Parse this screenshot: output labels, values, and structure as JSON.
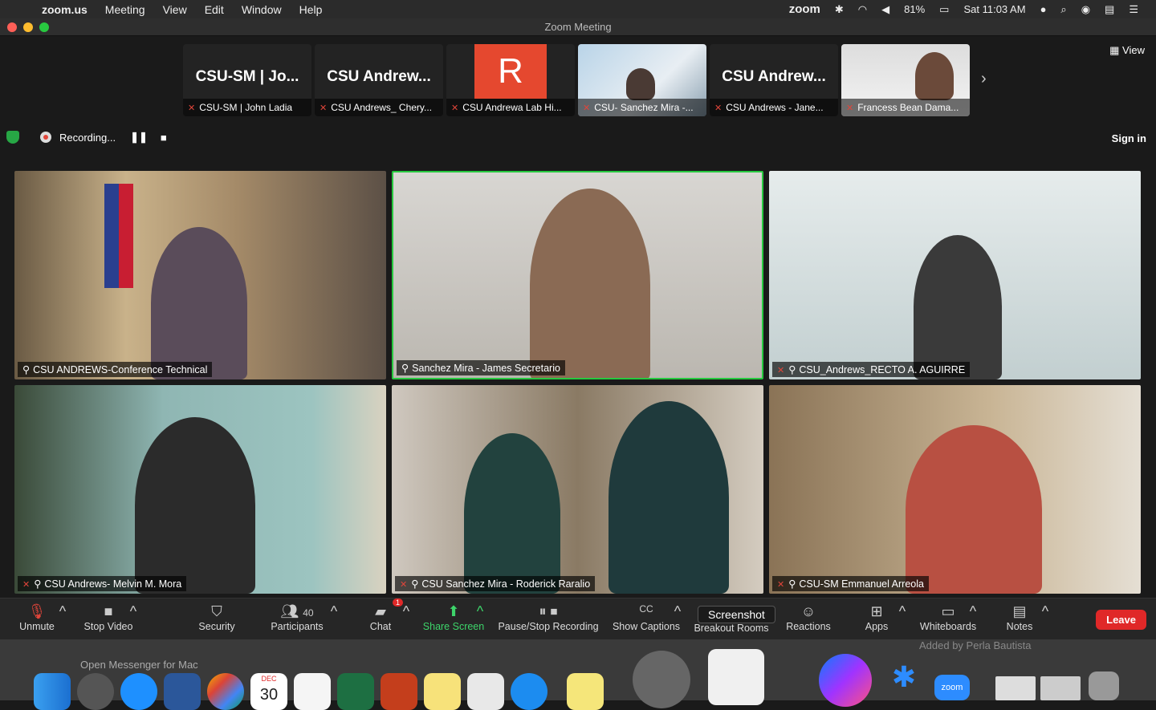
{
  "menubar": {
    "app": "zoom.us",
    "items": [
      "Meeting",
      "View",
      "Edit",
      "Window",
      "Help"
    ],
    "brand": "zoom",
    "battery": "81%",
    "clock": "Sat 11:03 AM"
  },
  "window": {
    "title": "Zoom Meeting"
  },
  "strip": [
    {
      "big": "CSU-SM | Jo...",
      "name": "CSU-SM | John Ladia"
    },
    {
      "big": "CSU Andrew...",
      "name": "CSU Andrews_ Chery..."
    },
    {
      "big": "R",
      "name": "CSU Andrewa Lab Hi..."
    },
    {
      "big": "",
      "name": "CSU- Sanchez Mira -..."
    },
    {
      "big": "CSU Andrew...",
      "name": "CSU Andrews - Jane..."
    },
    {
      "big": "",
      "name": "Francess Bean Dama..."
    }
  ],
  "view_label": "View",
  "recording": {
    "label": "Recording..."
  },
  "signin_label": "Sign in",
  "tiles": [
    {
      "name": "CSU ANDREWS-Conference Technical"
    },
    {
      "name": "Sanchez Mira - James Secretario"
    },
    {
      "name": "CSU_Andrews_RECTO A. AGUIRRE"
    },
    {
      "name": "CSU Andrews- Melvin M. Mora"
    },
    {
      "name": "CSU Sanchez Mira - Roderick Raralio"
    },
    {
      "name": "CSU-SM Emmanuel Arreola"
    }
  ],
  "toolbar": {
    "unmute": "Unmute",
    "stop_video": "Stop Video",
    "security": "Security",
    "participants": "Participants",
    "participants_count": "40",
    "chat": "Chat",
    "chat_badge": "1",
    "share": "Share Screen",
    "pause_rec": "Pause/Stop Recording",
    "captions": "Show Captions",
    "breakout": "Breakout Rooms",
    "reactions": "Reactions",
    "apps": "Apps",
    "whiteboards": "Whiteboards",
    "notes": "Notes",
    "leave": "Leave",
    "tooltip": "Screenshot"
  },
  "dock": {
    "behind_text": "Open Messenger for Mac",
    "behind_right": "Added by Perla Bautista",
    "calendar_month": "DEC",
    "calendar_day": "30",
    "zoom_label": "zoom"
  },
  "colors": {
    "accent_green": "#3dd46a",
    "leave_red": "#e02828",
    "active_border": "#27c93f"
  }
}
